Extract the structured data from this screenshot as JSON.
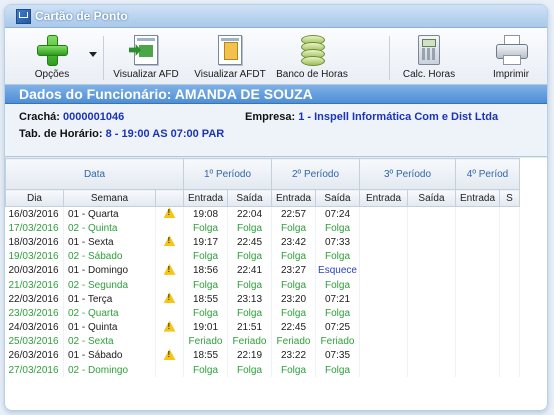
{
  "window": {
    "title": "Cartão de Ponto"
  },
  "toolbar": {
    "opcoes": "Opções",
    "visualizar_afd": "Visualizar AFD",
    "visualizar_afdt": "Visualizar AFDT",
    "banco_horas": "Banco de Horas",
    "calc_horas": "Calc. Horas",
    "imprimir": "Imprimir"
  },
  "employee": {
    "header": "Dados do Funcionário: AMANDA DE SOUZA",
    "cracha_label": "Crachá:",
    "cracha_value": "0000001046",
    "empresa_label": "Empresa:",
    "empresa_value": "1 - Inspell Informática Com e Dist Ltda",
    "horario_label": "Tab. de Horário:",
    "horario_value": "8 - 19:00 AS 07:00 PAR"
  },
  "table": {
    "group_headers": [
      "Data",
      "1º Período",
      "2º Período",
      "3º Período",
      "4º Períod"
    ],
    "columns": [
      "Dia",
      "Semana",
      "Entrada",
      "Saída",
      "Entrada",
      "Saída",
      "Entrada",
      "Saída",
      "Entrada",
      "S"
    ],
    "rows": [
      {
        "dia": "16/03/2016",
        "semana": "01 - Quarta",
        "warn": true,
        "e1": "19:08",
        "s1": "22:04",
        "e2": "22:57",
        "s2": "07:24",
        "style": "black"
      },
      {
        "dia": "17/03/2016",
        "semana": "02 - Quinta",
        "warn": false,
        "e1": "Folga",
        "s1": "Folga",
        "e2": "Folga",
        "s2": "Folga",
        "style": "green"
      },
      {
        "dia": "18/03/2016",
        "semana": "01 - Sexta",
        "warn": true,
        "e1": "19:17",
        "s1": "22:45",
        "e2": "23:42",
        "s2": "07:33",
        "style": "black"
      },
      {
        "dia": "19/03/2016",
        "semana": "02 - Sábado",
        "warn": false,
        "e1": "Folga",
        "s1": "Folga",
        "e2": "Folga",
        "s2": "Folga",
        "style": "green"
      },
      {
        "dia": "20/03/2016",
        "semana": "01 - Domingo",
        "warn": true,
        "e1": "18:56",
        "s1": "22:41",
        "e2": "23:27",
        "s2": "Esquece",
        "style": "black"
      },
      {
        "dia": "21/03/2016",
        "semana": "02 - Segunda",
        "warn": false,
        "e1": "Folga",
        "s1": "Folga",
        "e2": "Folga",
        "s2": "Folga",
        "style": "green"
      },
      {
        "dia": "22/03/2016",
        "semana": "01 - Terça",
        "warn": true,
        "e1": "18:55",
        "s1": "23:13",
        "e2": "23:20",
        "s2": "07:21",
        "style": "black"
      },
      {
        "dia": "23/03/2016",
        "semana": "02 - Quarta",
        "warn": false,
        "e1": "Folga",
        "s1": "Folga",
        "e2": "Folga",
        "s2": "Folga",
        "style": "green"
      },
      {
        "dia": "24/03/2016",
        "semana": "01 - Quinta",
        "warn": true,
        "e1": "19:01",
        "s1": "21:51",
        "e2": "22:45",
        "s2": "07:25",
        "style": "black"
      },
      {
        "dia": "25/03/2016",
        "semana": "02 - Sexta",
        "warn": false,
        "e1": "Feriado",
        "s1": "Feriado",
        "e2": "Feriado",
        "s2": "Feriado",
        "style": "green"
      },
      {
        "dia": "26/03/2016",
        "semana": "01 - Sábado",
        "warn": true,
        "e1": "18:55",
        "s1": "22:19",
        "e2": "23:22",
        "s2": "07:35",
        "style": "black"
      },
      {
        "dia": "27/03/2016",
        "semana": "02 - Domingo",
        "warn": false,
        "e1": "Folga",
        "s1": "Folga",
        "e2": "Folga",
        "s2": "Folga",
        "style": "green"
      }
    ]
  }
}
